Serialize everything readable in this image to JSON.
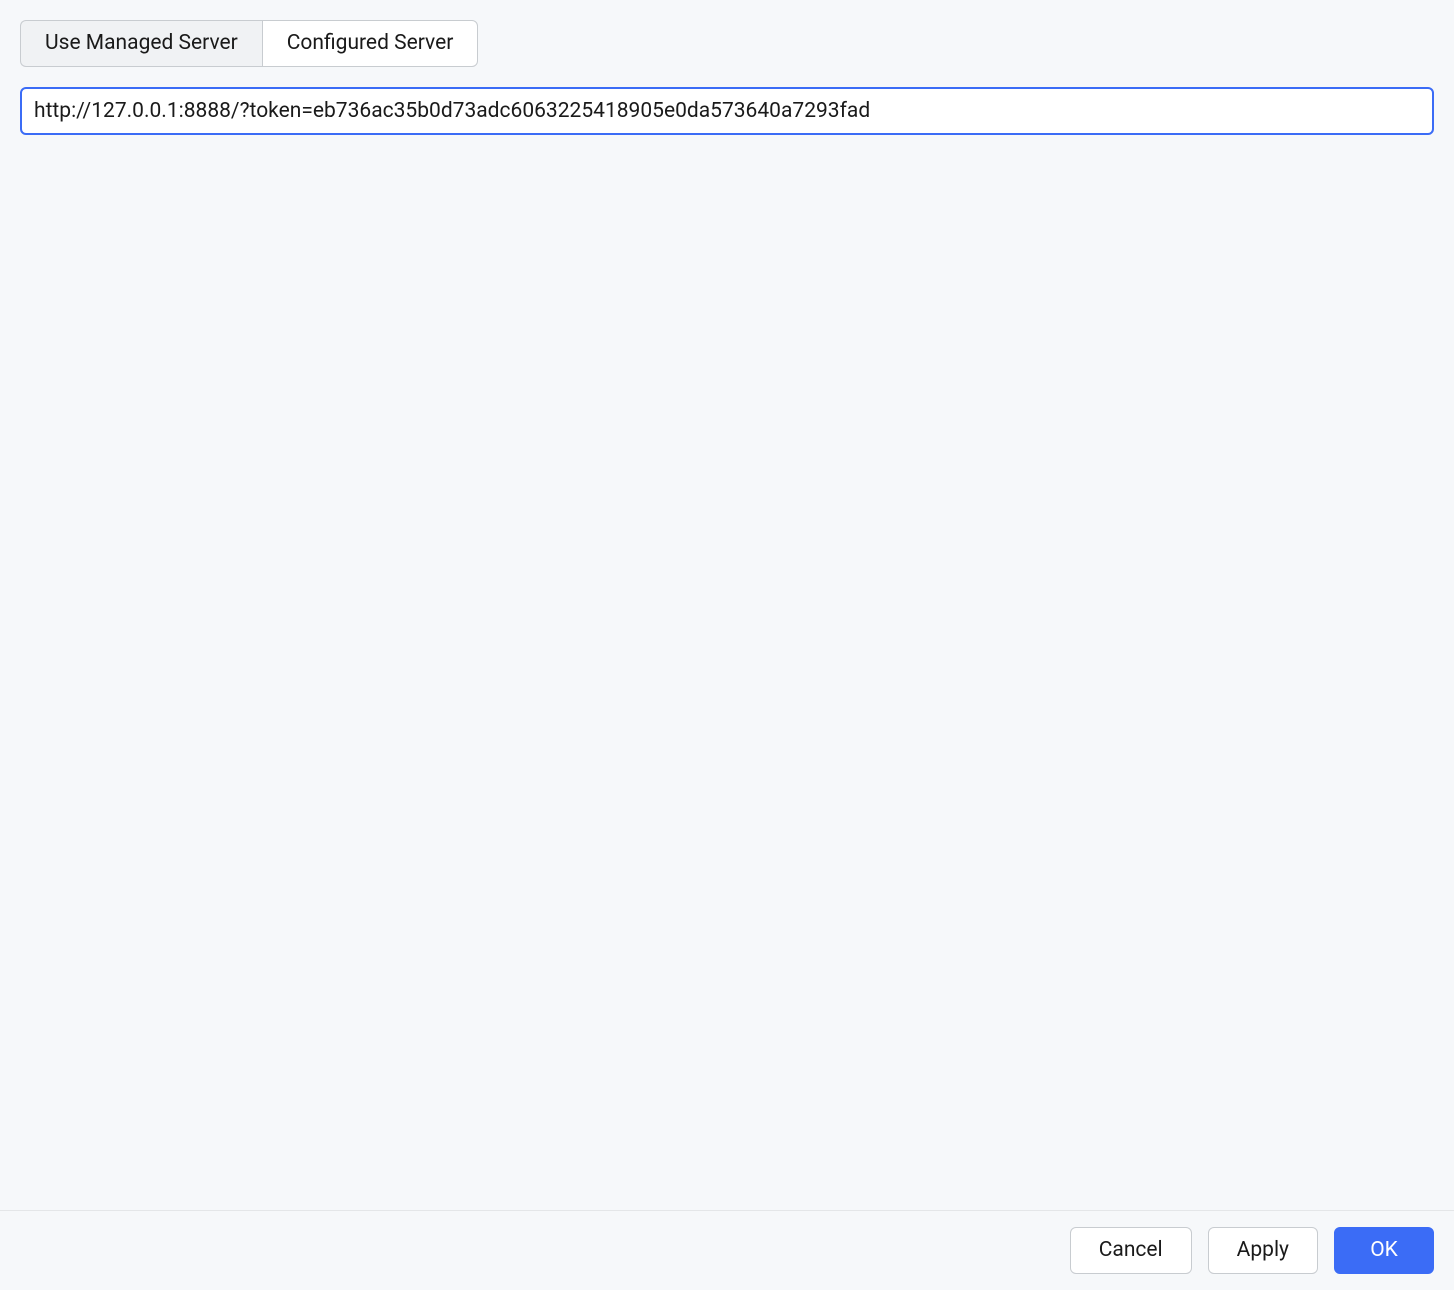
{
  "tabs": {
    "managed": "Use Managed Server",
    "configured": "Configured Server"
  },
  "server_url": "http://127.0.0.1:8888/?token=eb736ac35b0d73adc6063225418905e0da573640a7293fad",
  "footer": {
    "cancel": "Cancel",
    "apply": "Apply",
    "ok": "OK"
  }
}
